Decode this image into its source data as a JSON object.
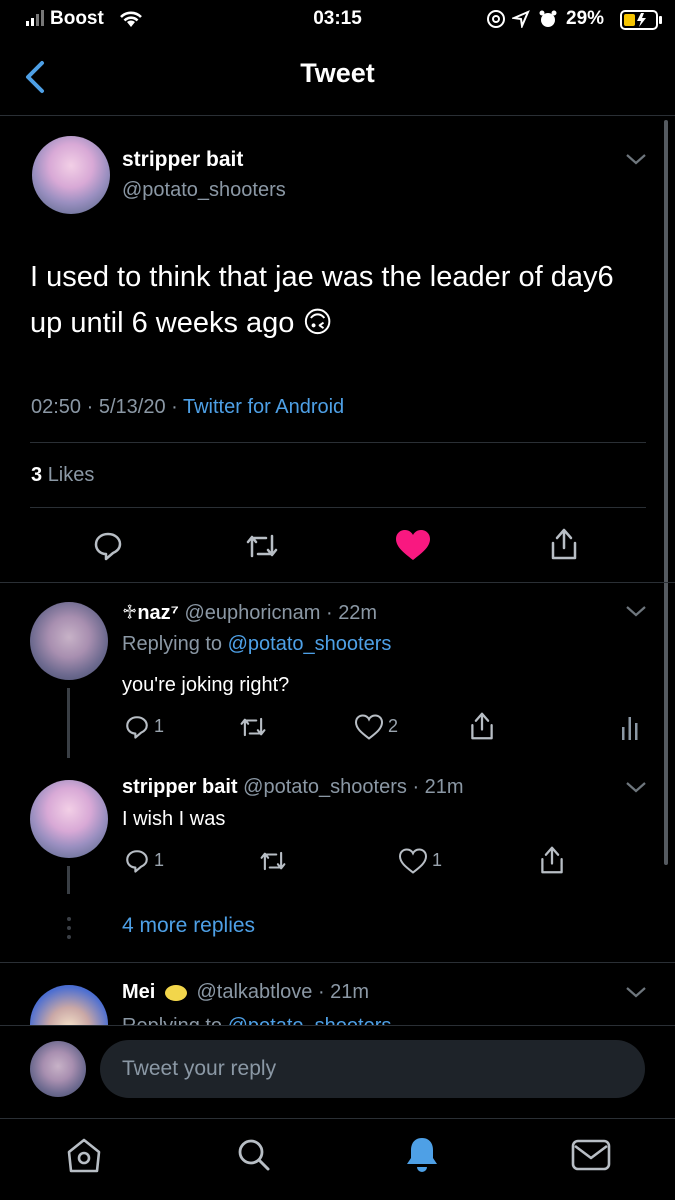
{
  "status_bar": {
    "carrier": "Boost",
    "time": "03:15",
    "battery": "29%"
  },
  "header": {
    "title": "Tweet"
  },
  "main_tweet": {
    "display_name": "stripper bait",
    "handle": "@potato_shooters",
    "text": "I used to think that jae was the leader of day6 up until 6 weeks ago 🙃",
    "time": "02:50",
    "date": "5/13/20",
    "source": "Twitter for Android",
    "likes_count": "3",
    "likes_label": "Likes"
  },
  "replies": [
    {
      "display_name": "♱naz⁷",
      "handle": "@euphoricnam",
      "age": "22m",
      "replying_prefix": "Replying to",
      "replying_to": "@potato_shooters",
      "text": "you're joking right?",
      "reply_count": "1",
      "like_count": "2"
    },
    {
      "display_name": "stripper bait",
      "handle": "@potato_shooters",
      "age": "21m",
      "text": "I wish I was",
      "reply_count": "1",
      "like_count": "1"
    },
    {
      "display_name": "Mei",
      "handle": "@talkabtlove",
      "age": "21m",
      "replying_prefix": "Replying to",
      "replying_to": "@potato_shooters"
    }
  ],
  "more_replies": "4 more replies",
  "compose": {
    "placeholder": "Tweet your reply"
  },
  "colors": {
    "like_active": "#f91880",
    "link": "#4ea0e6",
    "background": "#000000"
  }
}
